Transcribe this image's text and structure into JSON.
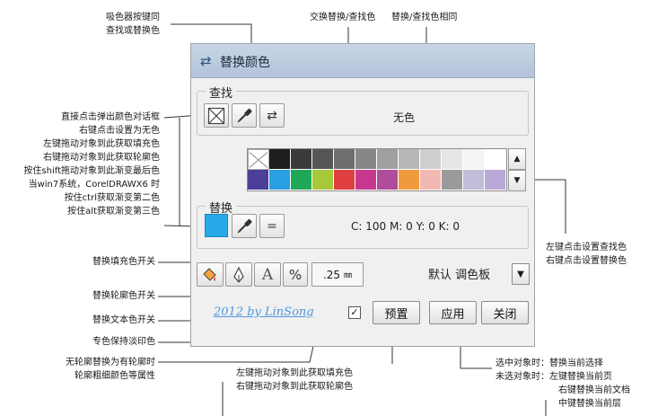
{
  "dialog": {
    "title": "替换颜色",
    "find": {
      "label": "查找",
      "value_text": "无色"
    },
    "replace": {
      "label": "替换",
      "value_text": "C: 100 M: 0 Y: 0 K: 0",
      "color": "#27a9e8"
    },
    "palette_row1": [
      "none",
      "#1e1e1e",
      "#3a3a3a",
      "#555555",
      "#6e6e6e",
      "#878787",
      "#9f9f9f",
      "#b7b7b7",
      "#cfcfcf",
      "#e6e6e6",
      "#f4f4f4",
      "#ffffff"
    ],
    "palette_row2": [
      "#4b3f9a",
      "#2a9fe2",
      "#1fa85a",
      "#a6c83b",
      "#e0403f",
      "#c8378e",
      "#b14b9b",
      "#ef9a3d",
      "#f2b8b3",
      "#9a9a9a",
      "#c0bdd8",
      "#b9a9d6"
    ],
    "palette_name": "默认 调色板",
    "outline_size": ".25",
    "outline_unit": "㎜",
    "signature": "2012 by LinSong",
    "checkbox_mark": "✓",
    "buttons": {
      "preset": "预置",
      "apply": "应用",
      "close": "关闭"
    },
    "tool_glyphs": {
      "swap": "⇄",
      "same": "=",
      "text": "A",
      "percent": "%",
      "down_arrow": "▼",
      "up_arrow": "▲"
    }
  },
  "annotations": {
    "eyedropper": [
      "吸色器按键同",
      "查找或替换色"
    ],
    "swap": "交换替换/查找色",
    "same": "替换/查找色相同",
    "left_list": [
      "直接点击弹出颜色对话框",
      "右键点击设置为无色",
      "左键拖动对象到此获取填充色",
      "右键拖动对象到此获取轮廓色",
      "按住shift拖动对象到此渐变最后色",
      "当win7系统，CorelDRAWX6 时",
      "按住ctrl获取渐变第二色",
      "按住alt获取渐变第三色"
    ],
    "palette_click": [
      "左键点击设置查找色",
      "右键点击设置替换色"
    ],
    "fill_switch": "替换填充色开关",
    "outline_switch": "替换轮廓色开关",
    "text_switch": "替换文本色开关",
    "spot_tint": "专色保持淡印色",
    "no_outline": [
      "无轮廓替换为有轮廓时",
      "轮廓粗细颜色等属性"
    ],
    "drag_drop": [
      "左键拖动对象到此获取填充色",
      "右键拖动对象到此获取轮廓色"
    ],
    "apply_scope": [
      "选中对象时：替换当前选择",
      "未选对象时：左键替换当前页",
      "右键替换当前文档",
      "中键替换当前层"
    ]
  }
}
